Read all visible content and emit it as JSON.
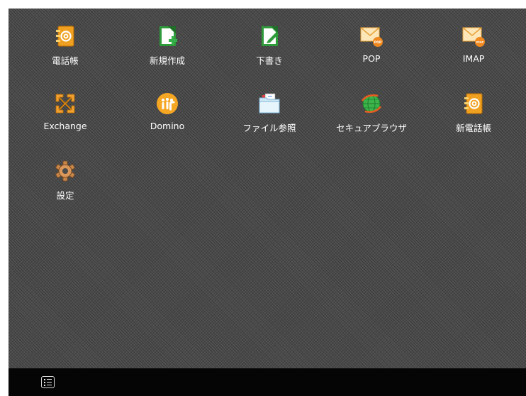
{
  "apps": [
    {
      "label": "電話帳",
      "icon": "address-book-icon"
    },
    {
      "label": "新規作成",
      "icon": "new-document-icon"
    },
    {
      "label": "下書き",
      "icon": "draft-icon"
    },
    {
      "label": "POP",
      "icon": "pop-mail-icon",
      "badge": "POP"
    },
    {
      "label": "IMAP",
      "icon": "imap-mail-icon",
      "badge": "IMAP"
    },
    {
      "label": "Exchange",
      "icon": "exchange-icon"
    },
    {
      "label": "Domino",
      "icon": "domino-icon"
    },
    {
      "label": "ファイル参照",
      "icon": "folder-icon"
    },
    {
      "label": "セキュアブラウザ",
      "icon": "secure-browser-icon"
    },
    {
      "label": "新電話帳",
      "icon": "new-address-book-icon"
    },
    {
      "label": "設定",
      "icon": "settings-gear-icon"
    }
  ],
  "bottom_bar": {
    "menu_icon": "list-menu-icon"
  },
  "colors": {
    "background": "#4b4b4b",
    "bar": "#050505",
    "label": "#ffffff",
    "orange": "#f0a030",
    "green": "#2e8b2e"
  }
}
